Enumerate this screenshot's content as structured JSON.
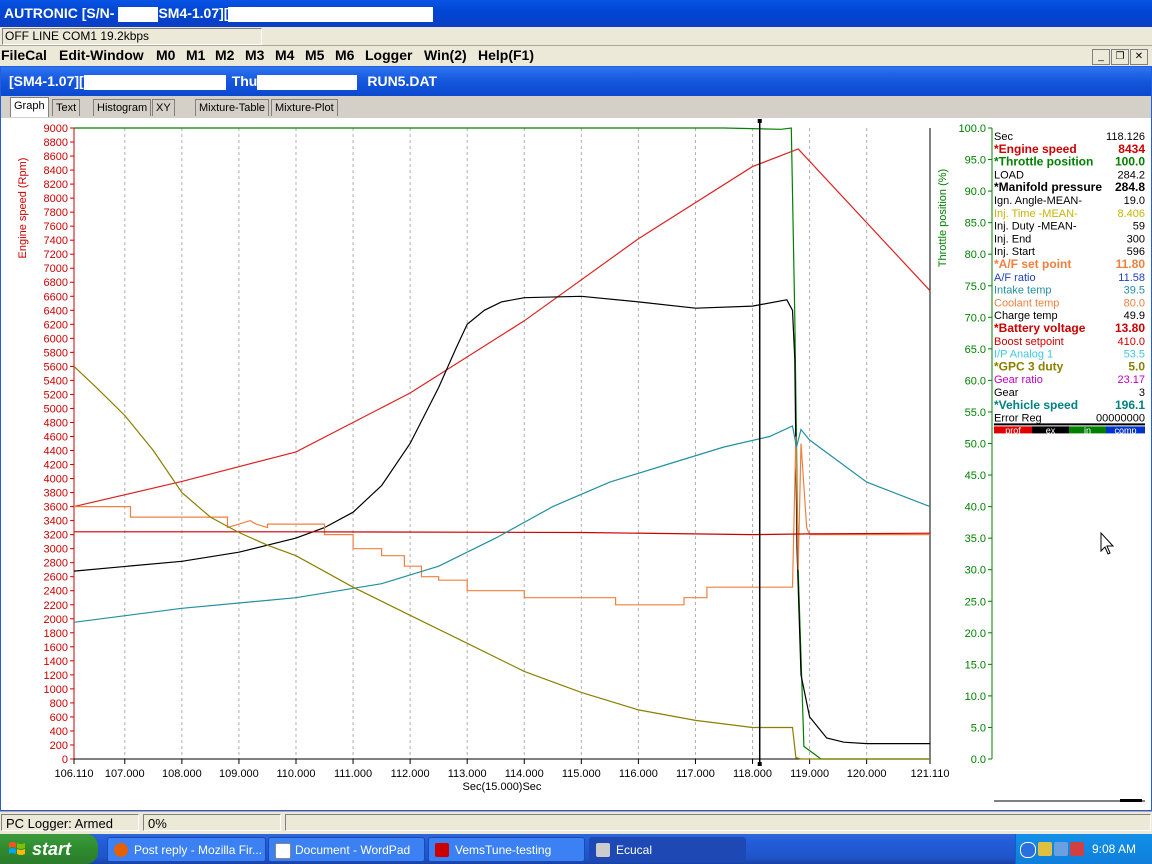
{
  "window": {
    "title_prefix": "AUTRONIC [S/N-",
    "title_mid": "SM4-1.07][",
    "status": "OFF LINE COM1 19.2kbps"
  },
  "menu": [
    "FileCal",
    "Edit-Window",
    "M0",
    "M1",
    "M2",
    "M3",
    "M4",
    "M5",
    "M6",
    "Logger",
    "Win(2)",
    "Help(F1)"
  ],
  "child": {
    "title_a": "[SM4-1.07][",
    "title_b": "Thu",
    "title_c": "RUN5.DAT"
  },
  "tabs": [
    "Graph",
    "Text",
    "Histogram",
    "XY",
    "Mixture-Table",
    "Mixture-Plot"
  ],
  "legend": [
    {
      "name": "Sec",
      "value": "118.126",
      "color": "#000000",
      "bold": false
    },
    {
      "name": "*Engine speed",
      "value": "8434",
      "color": "#cc0000",
      "bold": true
    },
    {
      "name": "*Throttle position",
      "value": "100.0",
      "color": "#008000",
      "bold": true
    },
    {
      "name": "LOAD",
      "value": "284.2",
      "color": "#000000",
      "bold": false
    },
    {
      "name": "*Manifold pressure",
      "value": "284.8",
      "color": "#000000",
      "bold": true
    },
    {
      "name": "Ign. Angle-MEAN-",
      "value": "19.0",
      "color": "#000000",
      "bold": false
    },
    {
      "name": "Inj. Time -MEAN-",
      "value": "8.406",
      "color": "#c8b400",
      "bold": false
    },
    {
      "name": "Inj. Duty -MEAN-",
      "value": "59",
      "color": "#000000",
      "bold": false
    },
    {
      "name": "Inj. End",
      "value": "300",
      "color": "#000000",
      "bold": false
    },
    {
      "name": "Inj. Start",
      "value": "596",
      "color": "#000000",
      "bold": false
    },
    {
      "name": "*A/F set point",
      "value": "11.80",
      "color": "#f08040",
      "bold": true
    },
    {
      "name": "A/F ratio",
      "value": "11.58",
      "color": "#2040c0",
      "bold": false
    },
    {
      "name": "Intake temp",
      "value": "39.5",
      "color": "#2090a0",
      "bold": false
    },
    {
      "name": "Coolant temp",
      "value": "80.0",
      "color": "#f08040",
      "bold": false
    },
    {
      "name": "Charge temp",
      "value": "49.9",
      "color": "#000000",
      "bold": false
    },
    {
      "name": "*Battery voltage",
      "value": "13.80",
      "color": "#cc0000",
      "bold": true
    },
    {
      "name": "Boost setpoint",
      "value": "410.0",
      "color": "#cc0000",
      "bold": false
    },
    {
      "name": "I/P Analog 1",
      "value": "53.5",
      "color": "#40c8e0",
      "bold": false
    },
    {
      "name": "*GPC 3 duty",
      "value": "5.0",
      "color": "#8a8000",
      "bold": true
    },
    {
      "name": "Gear ratio",
      "value": "23.17",
      "color": "#c000c0",
      "bold": false
    },
    {
      "name": "Gear",
      "value": "3",
      "color": "#000000",
      "bold": false
    },
    {
      "name": "*Vehicle speed",
      "value": "196.1",
      "color": "#008080",
      "bold": true
    },
    {
      "name": "Error Reg",
      "value": "00000000",
      "color": "#000000",
      "bold": false
    }
  ],
  "lambda_bar": {
    "labels": [
      "prof",
      "ex",
      "in",
      "comp"
    ]
  },
  "bottom": {
    "logger": "PC Logger: Armed",
    "percent": "0%"
  },
  "taskbar": {
    "start": "start",
    "tasks": [
      "Post reply - Mozilla Fir...",
      "Document - WordPad",
      "VemsTune-testing",
      "Ecucal"
    ],
    "clock": "9:08 AM"
  },
  "chart_data": {
    "type": "line",
    "xlabel": "Sec(15.000)Sec",
    "ylabel_left": "Engine speed (Rpm)",
    "ylabel_right": "Throttle position (%)",
    "xlim": [
      106.11,
      121.11
    ],
    "x_ticks": [
      "106.110",
      "107.000",
      "108.000",
      "109.000",
      "110.000",
      "111.000",
      "112.000",
      "113.000",
      "114.000",
      "115.000",
      "116.000",
      "117.000",
      "118.000",
      "119.000",
      "120.000",
      "121.110"
    ],
    "ylim_left": [
      0,
      9000
    ],
    "ylim_right": [
      0,
      100
    ],
    "cursor_x": 118.126,
    "series": [
      {
        "name": "Engine speed",
        "color": "#dd2222",
        "axis": "left",
        "x": [
          106.11,
          108,
          110,
          112,
          114,
          116,
          118,
          118.8,
          121.11
        ],
        "y": [
          3600,
          3960,
          4380,
          5220,
          6250,
          7420,
          8450,
          8700,
          6680
        ]
      },
      {
        "name": "Throttle position",
        "color": "#008000",
        "axis": "right",
        "x": [
          106.11,
          110,
          115,
          117.5,
          118.5,
          118.68,
          118.74,
          118.8,
          118.9,
          119.2,
          121.11
        ],
        "y": [
          100,
          100,
          100,
          100,
          99.8,
          100,
          70,
          30,
          2,
          0,
          0
        ]
      },
      {
        "name": "Manifold pressure",
        "color": "#000000",
        "axis": "left",
        "x": [
          106.11,
          108,
          109,
          110,
          110.5,
          111,
          111.5,
          112,
          112.5,
          112.8,
          113,
          113.3,
          113.6,
          114,
          115,
          116,
          117,
          118,
          118.6,
          118.7,
          118.74,
          118.78,
          118.85,
          119,
          119.3,
          119.6,
          120,
          121.11
        ],
        "y": [
          2680,
          2820,
          2950,
          3150,
          3300,
          3520,
          3900,
          4500,
          5300,
          5850,
          6200,
          6400,
          6520,
          6580,
          6600,
          6520,
          6430,
          6460,
          6550,
          6400,
          5700,
          3000,
          1200,
          600,
          300,
          240,
          220,
          220
        ]
      },
      {
        "name": "A/F set point",
        "color": "#f08040",
        "axis": "left",
        "x": [
          106.11,
          107.1,
          107.1,
          108.8,
          108.8,
          109.2,
          109.3,
          109.5,
          109.5,
          110.5,
          110.5,
          111,
          111,
          111.5,
          111.5,
          111.9,
          111.9,
          112.2,
          112.2,
          112.5,
          112.5,
          113,
          113,
          114,
          114,
          115.6,
          115.6,
          116.8,
          116.8,
          117.2,
          117.2,
          118.7,
          118.76,
          118.8,
          118.85,
          118.95,
          119,
          121.11
        ],
        "y": [
          3600,
          3600,
          3450,
          3450,
          3300,
          3400,
          3350,
          3300,
          3350,
          3350,
          3200,
          3200,
          3000,
          3000,
          2900,
          2900,
          2750,
          2750,
          2600,
          2600,
          2550,
          2550,
          2400,
          2400,
          2300,
          2300,
          2200,
          2200,
          2300,
          2300,
          2450,
          2450,
          4600,
          2700,
          4500,
          3300,
          3200,
          3200
        ]
      },
      {
        "name": "Battery voltage",
        "color": "#cc0000",
        "axis": "left",
        "x": [
          106.11,
          110,
          115,
          118,
          119,
          121.11
        ],
        "y": [
          3240,
          3240,
          3230,
          3200,
          3210,
          3220
        ]
      },
      {
        "name": "Intake temp",
        "color": "#2090a0",
        "axis": "left",
        "x": [
          106.11,
          108,
          110,
          111.5,
          112.5,
          113.5,
          114.5,
          115.5,
          116.5,
          117.5,
          118.3,
          118.7,
          118.77,
          118.85,
          119,
          120,
          121.11
        ],
        "y": [
          1950,
          2150,
          2300,
          2500,
          2750,
          3150,
          3600,
          3950,
          4200,
          4450,
          4600,
          4750,
          4450,
          4700,
          4550,
          3950,
          3600
        ]
      },
      {
        "name": "GPC 3 duty",
        "color": "#8a8000",
        "axis": "left",
        "x": [
          106.11,
          106.5,
          107,
          107.5,
          108,
          108.5,
          109,
          109.5,
          110,
          111,
          112,
          113,
          114,
          115,
          116,
          117,
          118,
          118.7,
          118.76,
          118.85,
          121.11
        ],
        "y": [
          5600,
          5300,
          4900,
          4400,
          3800,
          3450,
          3230,
          3050,
          2900,
          2450,
          2050,
          1650,
          1250,
          950,
          700,
          550,
          450,
          450,
          20,
          0,
          0
        ]
      }
    ]
  }
}
